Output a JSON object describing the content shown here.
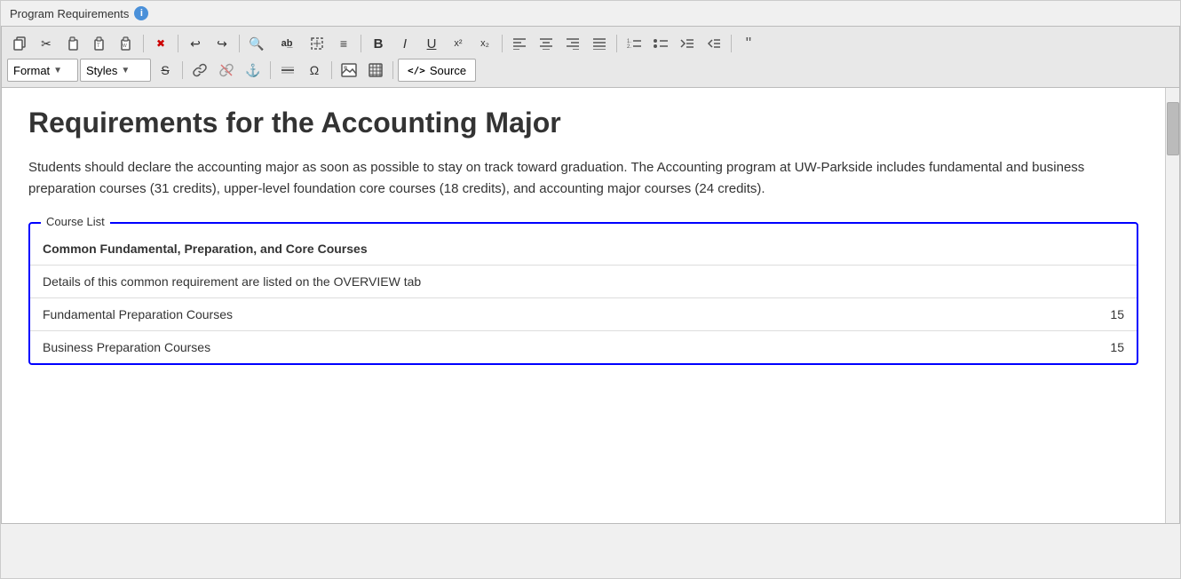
{
  "window": {
    "title": "Program Requirements",
    "info_icon": "i"
  },
  "toolbar": {
    "row1": {
      "buttons": [
        {
          "name": "copy-button",
          "icon": "copy-icon",
          "symbol": "⎘",
          "label": "Copy"
        },
        {
          "name": "cut-button",
          "icon": "cut-icon",
          "symbol": "✂",
          "label": "Cut"
        },
        {
          "name": "paste-button",
          "icon": "paste-icon",
          "symbol": "❑",
          "label": "Paste"
        },
        {
          "name": "paste-text-button",
          "icon": "paste-text-icon",
          "symbol": "❒",
          "label": "Paste as plain text"
        },
        {
          "name": "paste-word-button",
          "icon": "paste-word-icon",
          "symbol": "❏",
          "label": "Paste from Word"
        },
        {
          "name": "remove-format-button",
          "icon": "remove-format-icon",
          "symbol": "✖",
          "label": "Remove Format"
        },
        {
          "name": "undo-button",
          "icon": "undo-icon",
          "symbol": "↩",
          "label": "Undo"
        },
        {
          "name": "redo-button",
          "icon": "redo-icon",
          "symbol": "↪",
          "label": "Redo"
        },
        {
          "name": "find-button",
          "icon": "find-icon",
          "symbol": "⌕",
          "label": "Find"
        },
        {
          "name": "replace-button",
          "icon": "replace-icon",
          "symbol": "ab",
          "label": "Replace"
        },
        {
          "name": "select-all-button",
          "icon": "select-all-icon",
          "symbol": "▦",
          "label": "Select All"
        },
        {
          "name": "spell-check-button",
          "icon": "spell-check-icon",
          "symbol": "≡",
          "label": "Spell Check"
        },
        {
          "name": "bold-button",
          "icon": "bold-icon",
          "symbol": "B",
          "label": "Bold"
        },
        {
          "name": "italic-button",
          "icon": "italic-icon",
          "symbol": "I",
          "label": "Italic"
        },
        {
          "name": "underline-button",
          "icon": "underline-icon",
          "symbol": "U",
          "label": "Underline"
        },
        {
          "name": "superscript-button",
          "icon": "superscript-icon",
          "symbol": "x²",
          "label": "Superscript"
        },
        {
          "name": "subscript-button",
          "icon": "subscript-icon",
          "symbol": "x₂",
          "label": "Subscript"
        },
        {
          "name": "align-left-button",
          "icon": "align-left-icon",
          "symbol": "≡",
          "label": "Align Left"
        },
        {
          "name": "align-center-button",
          "icon": "align-center-icon",
          "symbol": "≡",
          "label": "Align Center"
        },
        {
          "name": "align-right-button",
          "icon": "align-right-icon",
          "symbol": "≡",
          "label": "Align Right"
        },
        {
          "name": "justify-button",
          "icon": "justify-icon",
          "symbol": "≡",
          "label": "Justify"
        },
        {
          "name": "ordered-list-button",
          "icon": "ordered-list-icon",
          "symbol": "⒈",
          "label": "Ordered List"
        },
        {
          "name": "unordered-list-button",
          "icon": "unordered-list-icon",
          "symbol": "⁃",
          "label": "Unordered List"
        },
        {
          "name": "indent-button",
          "icon": "indent-icon",
          "symbol": "→",
          "label": "Indent"
        },
        {
          "name": "outdent-button",
          "icon": "outdent-icon",
          "symbol": "←",
          "label": "Outdent"
        },
        {
          "name": "blockquote-button",
          "icon": "blockquote-icon",
          "symbol": "\"",
          "label": "Blockquote"
        }
      ]
    },
    "row2": {
      "format_label": "Format",
      "styles_label": "Styles",
      "strike_symbol": "S",
      "link_symbol": "🔗",
      "unlink_symbol": "⛓",
      "anchor_symbol": "⚓",
      "hr_symbol": "─",
      "omega_symbol": "Ω",
      "image_symbol": "🖼",
      "table_symbol": "⊞",
      "source_label": "Source",
      "source_symbol": "</"
    }
  },
  "editor": {
    "page_title": "Requirements for the Accounting Major",
    "intro_paragraph": "Students should declare the accounting major as soon as possible to stay on track toward graduation. The Accounting program at UW-Parkside includes fundamental and business preparation courses (31 credits), upper-level foundation core courses (18 credits), and accounting major courses (24 credits).",
    "course_list": {
      "label": "Course List",
      "rows": [
        {
          "type": "header",
          "course": "Common Fundamental, Preparation, and Core Courses",
          "credits": ""
        },
        {
          "type": "detail",
          "course": "Details of this common requirement are listed on the OVERVIEW tab",
          "credits": ""
        },
        {
          "type": "row",
          "course": "Fundamental Preparation Courses",
          "credits": "15"
        },
        {
          "type": "row",
          "course": "Business Preparation Courses",
          "credits": "15"
        }
      ]
    }
  }
}
